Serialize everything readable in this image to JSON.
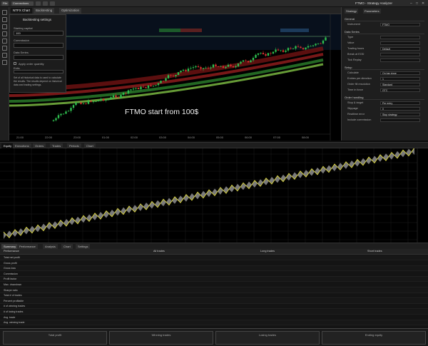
{
  "topbar": {
    "buttons": [
      "File",
      "Connections",
      "",
      "",
      "",
      "",
      "",
      "",
      ""
    ],
    "title": "FTMO - Strategy Analyzer",
    "window_controls": [
      "–",
      "□",
      "✕"
    ]
  },
  "chart_tabs": [
    "NTFX Chart",
    "Backtesting",
    "Optimization"
  ],
  "chart": {
    "annotation": "FTMO start from 100$",
    "time_labels": [
      "21:00",
      "22:00",
      "23:00",
      "01:00",
      "02:00",
      "03:00",
      "04:00",
      "05:00",
      "06:00",
      "07:00",
      "08:00"
    ]
  },
  "settings_panel": {
    "title": "Backtesting settings",
    "fields": [
      {
        "label": "Starting capital",
        "value": "100"
      },
      {
        "label": "Commission",
        "value": ""
      },
      {
        "label": "Data Series",
        "value": ""
      }
    ],
    "checkbox_label": "Apply order quantity",
    "select_label": "Exits",
    "select_value": "",
    "note": "Set of all historical data is used to calculate the results. The results depend on historical data and trading settings."
  },
  "right_panel": {
    "tabs": [
      "Strategy",
      "Parameters"
    ],
    "sections": [
      {
        "title": "General",
        "rows": [
          {
            "label": "Instrument",
            "value": "FTMO"
          }
        ]
      },
      {
        "title": "Data Series",
        "rows": [
          {
            "label": "Type",
            "value": ""
          },
          {
            "label": "Value",
            "value": ""
          },
          {
            "label": "Trading hours",
            "value": "Default"
          },
          {
            "label": "Break at EOD",
            "value": ""
          },
          {
            "label": "Tick Replay",
            "value": ""
          }
        ]
      },
      {
        "title": "Setup",
        "rows": [
          {
            "label": "Calculate",
            "value": "On bar close"
          },
          {
            "label": "Entries per direction",
            "value": "1"
          },
          {
            "label": "Order fill resolution",
            "value": "Standard"
          },
          {
            "label": "Time in force",
            "value": "GTC"
          }
        ]
      },
      {
        "title": "Order handling",
        "rows": [
          {
            "label": "Stop & target",
            "value": "Per entry"
          },
          {
            "label": "Slippage",
            "value": "0"
          },
          {
            "label": "Realtime error",
            "value": "Stop strategy"
          },
          {
            "label": "Include commission",
            "value": ""
          }
        ]
      }
    ]
  },
  "results_tabs": [
    "Equity",
    "Executions",
    "Orders",
    "Trades",
    "Periods",
    "Chart"
  ],
  "stat_tabs": [
    "Summary",
    "Performance",
    "Analysis",
    "Chart",
    "Settings"
  ],
  "stats": {
    "headers": [
      "Performance",
      "All trades",
      "Long trades",
      "Short trades"
    ],
    "rows": [
      {
        "label": "Total net profit",
        "all": "",
        "long": "",
        "short": ""
      },
      {
        "label": "Gross profit",
        "all": "",
        "long": "",
        "short": ""
      },
      {
        "label": "Gross loss",
        "all": "",
        "long": "",
        "short": ""
      },
      {
        "label": "Commission",
        "all": "",
        "long": "",
        "short": ""
      },
      {
        "label": "Profit factor",
        "all": "",
        "long": "",
        "short": ""
      },
      {
        "label": "Max. drawdown",
        "all": "",
        "long": "",
        "short": ""
      },
      {
        "label": "Sharpe ratio",
        "all": "",
        "long": "",
        "short": ""
      },
      {
        "label": "Total # of trades",
        "all": "",
        "long": "",
        "short": ""
      },
      {
        "label": "Percent profitable",
        "all": "",
        "long": "",
        "short": ""
      },
      {
        "label": "# of winning trades",
        "all": "",
        "long": "",
        "short": ""
      },
      {
        "label": "# of losing trades",
        "all": "",
        "long": "",
        "short": ""
      },
      {
        "label": "Avg. trade",
        "all": "",
        "long": "",
        "short": ""
      },
      {
        "label": "Avg. winning trade",
        "all": "",
        "long": "",
        "short": ""
      }
    ]
  },
  "footer": [
    {
      "label": "Total profit",
      "value": ""
    },
    {
      "label": "Winning trades",
      "value": ""
    },
    {
      "label": "Losing trades",
      "value": ""
    },
    {
      "label": "Ending equity",
      "value": ""
    }
  ],
  "equity_axis": []
}
